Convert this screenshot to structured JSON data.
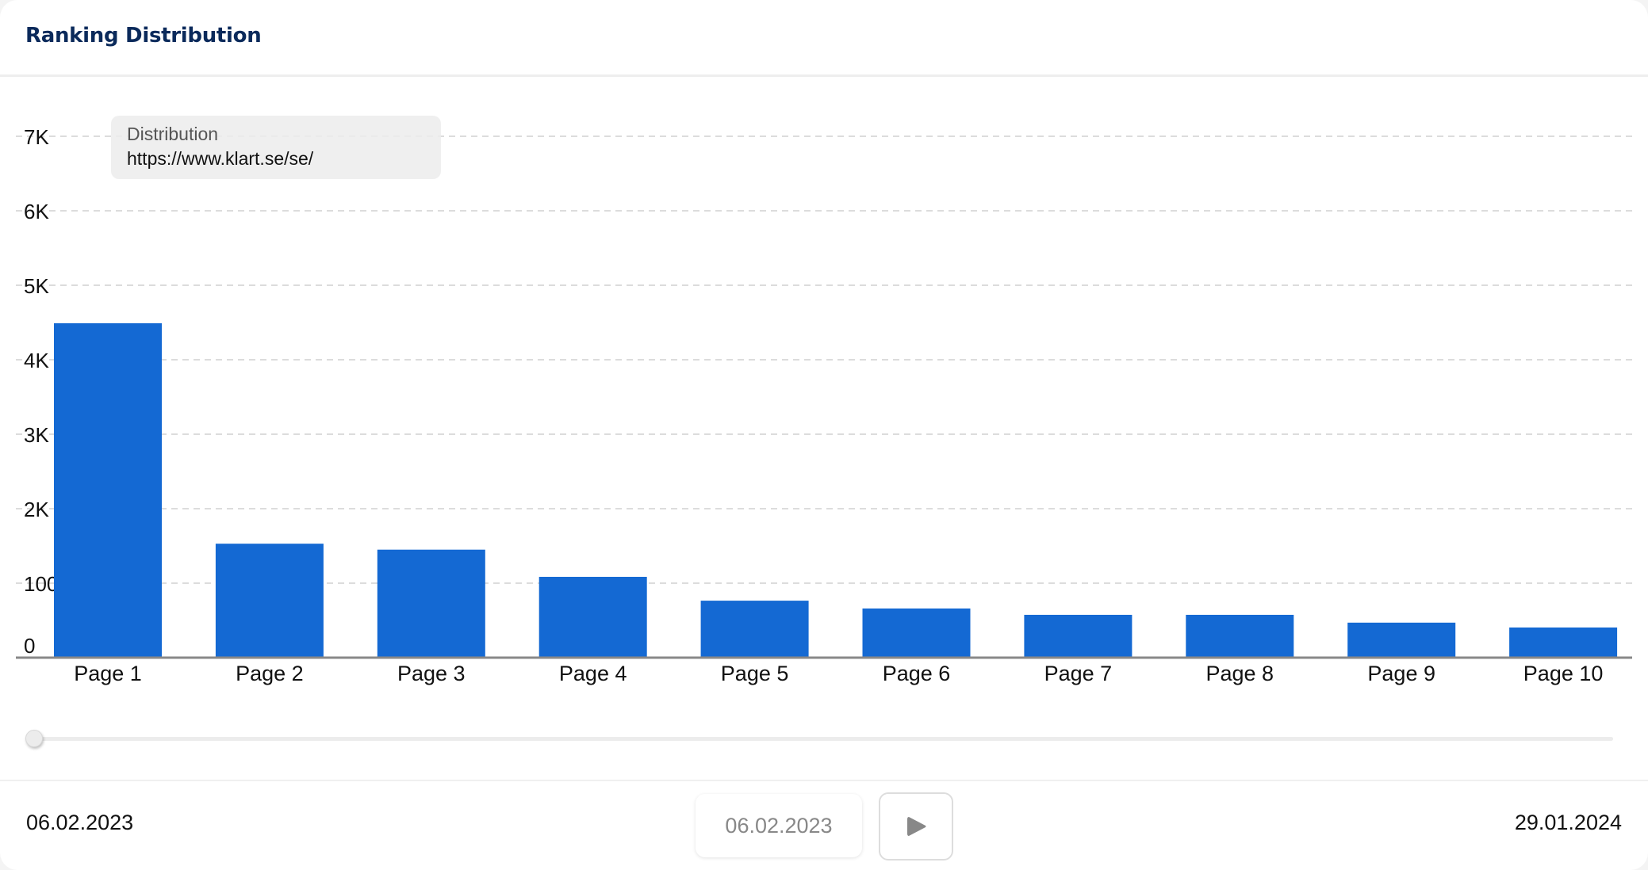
{
  "header": {
    "title": "Ranking Distribution"
  },
  "tooltip": {
    "series_label": "Distribution",
    "url": "https://www.klart.se/se/"
  },
  "timeline": {
    "start_date": "06.02.2023",
    "end_date": "29.01.2024",
    "current_date": "06.02.2023",
    "slider_position": 0,
    "play_icon": "play-icon"
  },
  "colors": {
    "bar": "#1469d3",
    "title": "#0b2a5b",
    "grid": "#dcdcdc",
    "axis": "#888888"
  },
  "chart_data": {
    "type": "bar",
    "title": "Ranking Distribution",
    "series_name": "Distribution",
    "categories": [
      "Page 1",
      "Page 2",
      "Page 3",
      "Page 4",
      "Page 5",
      "Page 6",
      "Page 7",
      "Page 8",
      "Page 9",
      "Page 10"
    ],
    "values": [
      4490,
      1530,
      1450,
      1085,
      765,
      660,
      575,
      575,
      470,
      405
    ],
    "ylim": [
      0,
      7000
    ],
    "yticks": [
      0,
      1000,
      2000,
      3000,
      4000,
      5000,
      6000,
      7000
    ],
    "ytick_labels": [
      "0",
      "1000",
      "2K",
      "3K",
      "4K",
      "5K",
      "6K",
      "7K"
    ],
    "xlabel": "",
    "ylabel": "",
    "grid": true,
    "legend": "none"
  }
}
